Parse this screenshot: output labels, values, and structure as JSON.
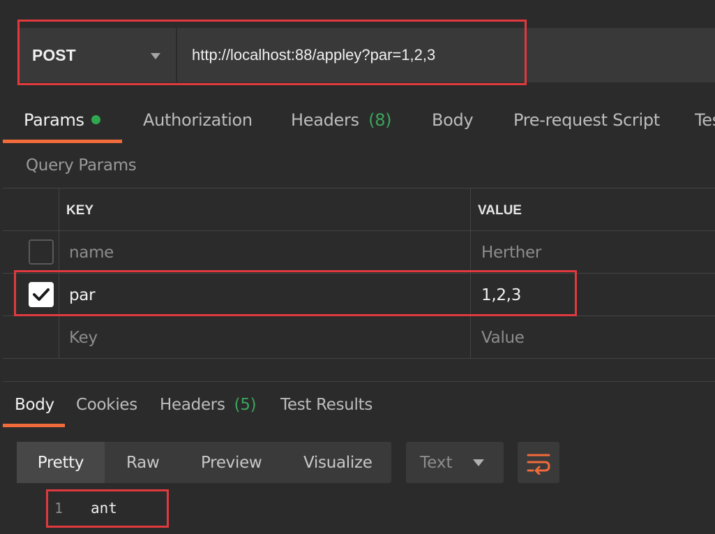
{
  "request": {
    "method": "POST",
    "url": "http://localhost:88/appley?par=1,2,3"
  },
  "request_tabs": [
    {
      "label": "Params",
      "active": true
    },
    {
      "label": "Authorization"
    },
    {
      "label": "Headers",
      "count": "(8)"
    },
    {
      "label": "Body"
    },
    {
      "label": "Pre-request Script"
    },
    {
      "label": "Tes"
    }
  ],
  "query_params": {
    "title": "Query Params",
    "columns": {
      "key": "KEY",
      "value": "VALUE"
    },
    "rows": [
      {
        "key": "name",
        "value": "Herther",
        "checked": false
      },
      {
        "key": "par",
        "value": "1,2,3",
        "checked": true
      }
    ],
    "placeholder": {
      "key": "Key",
      "value": "Value"
    }
  },
  "response_tabs": [
    {
      "label": "Body",
      "active": true
    },
    {
      "label": "Cookies"
    },
    {
      "label": "Headers",
      "count": "(5)"
    },
    {
      "label": "Test Results"
    }
  ],
  "view_modes": [
    "Pretty",
    "Raw",
    "Preview",
    "Visualize"
  ],
  "active_view": "Pretty",
  "format_select": "Text",
  "response_body": {
    "line_number": "1",
    "text": "ant"
  },
  "colors": {
    "accent": "#f26b3a",
    "highlight": "#e0393e",
    "success": "#2fa84f"
  }
}
